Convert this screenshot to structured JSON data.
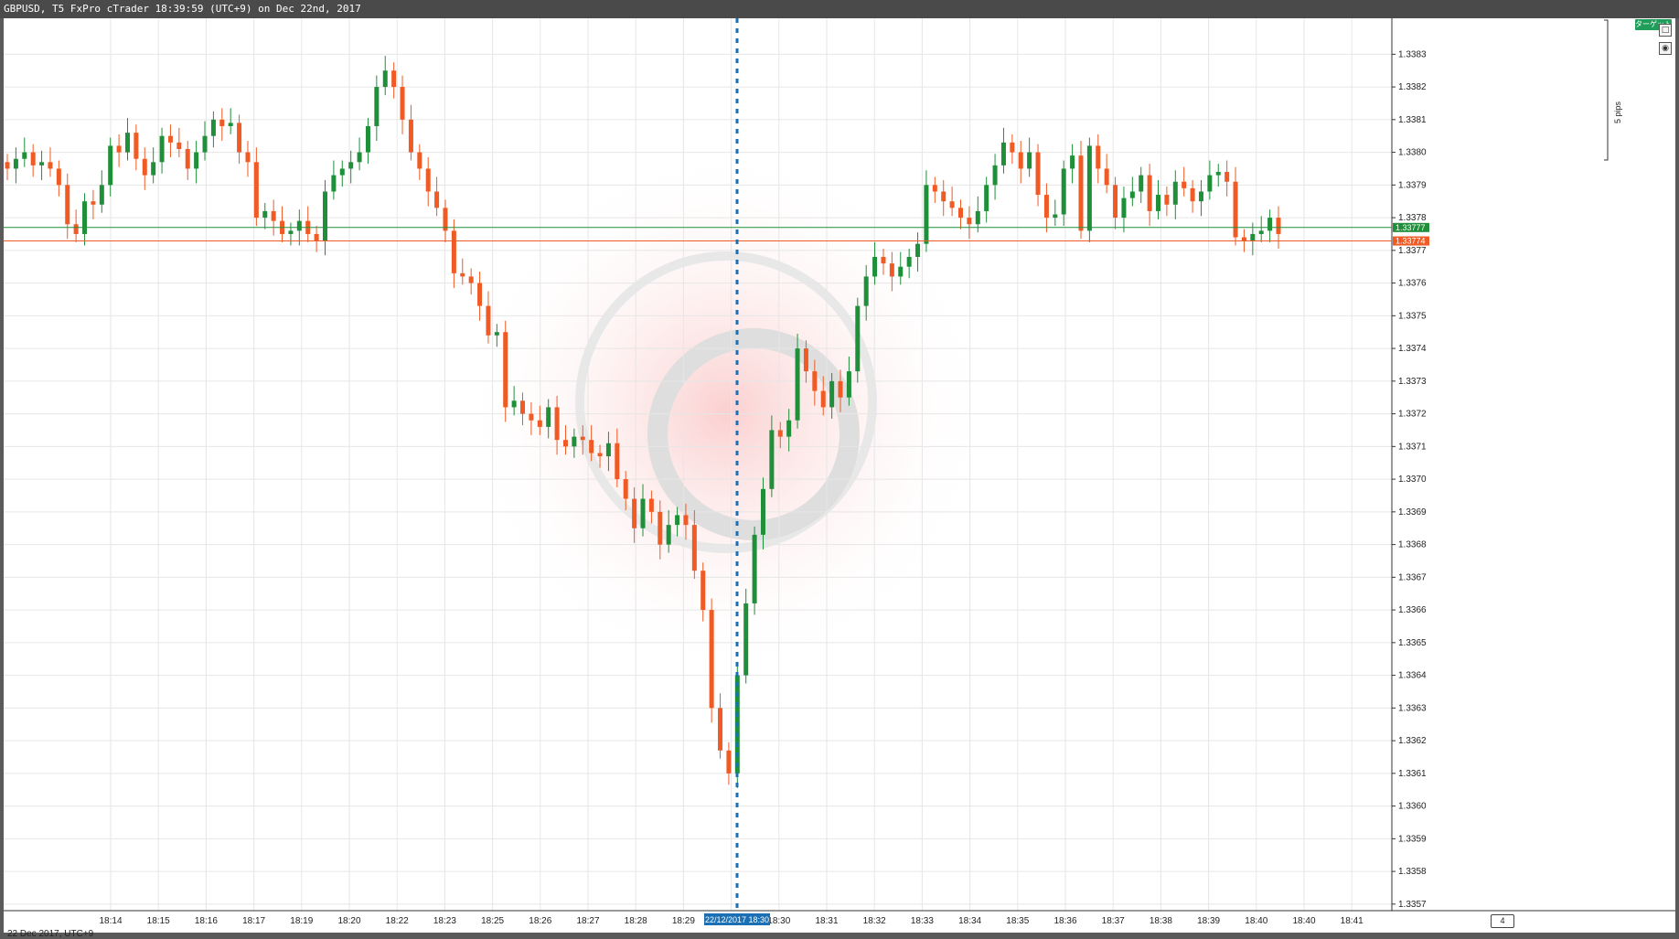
{
  "window": {
    "title": "GBPUSD, T5 FxPro cTrader 18:39:59 (UTC+9) on Dec 22nd, 2017"
  },
  "chart_data": {
    "type": "candlestick",
    "symbol": "GBPUSD",
    "timeframe": "T5",
    "date_label": "22 Dec 2017, UTC+9",
    "x_tick_labels": [
      "18:14",
      "18:15",
      "18:16",
      "18:17",
      "18:19",
      "18:20",
      "18:22",
      "18:23",
      "18:25",
      "18:26",
      "18:27",
      "18:28",
      "18:29",
      "18:30",
      "18:30",
      "18:31",
      "18:32",
      "18:33",
      "18:34",
      "18:35",
      "18:36",
      "18:37",
      "18:38",
      "18:39",
      "18:40",
      "18:40",
      "18:41"
    ],
    "crosshair_time_label": "22/12/2017 18:30",
    "y_tick_labels": [
      "1.3383",
      "1.3382",
      "1.3381",
      "1.3380",
      "1.3379",
      "1.3378",
      "1.3377",
      "1.3376",
      "1.3375",
      "1.3374",
      "1.3373",
      "1.3372",
      "1.3371",
      "1.3370",
      "1.3369",
      "1.3368",
      "1.3367",
      "1.3366",
      "1.3365",
      "1.3364",
      "1.3363",
      "1.3362",
      "1.3361",
      "1.3360",
      "1.3359",
      "1.3358",
      "1.3357"
    ],
    "ylim": [
      1.33568,
      1.33841
    ],
    "ask_line": "1.33777",
    "bid_line": "1.33774",
    "ask_value": 1.33777,
    "bid_value": 1.33774,
    "close_series": [
      1.33795,
      1.33798,
      1.338,
      1.33796,
      1.33797,
      1.33795,
      1.3379,
      1.33778,
      1.33775,
      1.33785,
      1.33784,
      1.3379,
      1.33802,
      1.338,
      1.33806,
      1.33798,
      1.33793,
      1.33797,
      1.33805,
      1.33803,
      1.33801,
      1.33795,
      1.338,
      1.33805,
      1.3381,
      1.33808,
      1.33809,
      1.338,
      1.33797,
      1.3378,
      1.33782,
      1.33779,
      1.33775,
      1.33776,
      1.33779,
      1.33775,
      1.33773,
      1.33788,
      1.33793,
      1.33795,
      1.33797,
      1.338,
      1.33808,
      1.3382,
      1.33825,
      1.3382,
      1.3381,
      1.338,
      1.33795,
      1.33788,
      1.33783,
      1.33776,
      1.33763,
      1.33762,
      1.3376,
      1.33753,
      1.33744,
      1.33745,
      1.33722,
      1.33724,
      1.3372,
      1.33718,
      1.33716,
      1.33722,
      1.33712,
      1.3371,
      1.33713,
      1.33712,
      1.33708,
      1.33707,
      1.33711,
      1.337,
      1.33694,
      1.33685,
      1.33694,
      1.3369,
      1.3368,
      1.33686,
      1.33689,
      1.33686,
      1.33672,
      1.3366,
      1.3363,
      1.33617,
      1.3361,
      1.3364,
      1.33662,
      1.33683,
      1.33697,
      1.33715,
      1.33713,
      1.33718,
      1.3374,
      1.33733,
      1.33727,
      1.33722,
      1.3373,
      1.33725,
      1.33733,
      1.33753,
      1.33762,
      1.33768,
      1.33766,
      1.33762,
      1.33765,
      1.33768,
      1.33772,
      1.3379,
      1.33788,
      1.33785,
      1.33783,
      1.3378,
      1.33778,
      1.33782,
      1.3379,
      1.33796,
      1.33803,
      1.338,
      1.33795,
      1.338,
      1.33787,
      1.3378,
      1.33781,
      1.33795,
      1.33799,
      1.33776,
      1.33802,
      1.33795,
      1.3379,
      1.3378,
      1.33786,
      1.33788,
      1.33793,
      1.33782,
      1.33787,
      1.33784,
      1.33791,
      1.33789,
      1.33785,
      1.33788,
      1.33793,
      1.33794,
      1.33791,
      1.33774,
      1.33773,
      1.33775,
      1.33776,
      1.3378,
      1.33775
    ],
    "colors": {
      "up": "#1f8f3a",
      "down": "#f05a24",
      "ask": "#1f8f3a",
      "bid": "#f05a24",
      "crosshair": "#1a6fb5",
      "grid": "#e6e6e6"
    }
  },
  "toolbar": {
    "target_badge": "ターゲット",
    "pips_label": "5 pips",
    "scroll_count": "4"
  },
  "icons": [
    "target-lock-icon",
    "camera-icon"
  ]
}
